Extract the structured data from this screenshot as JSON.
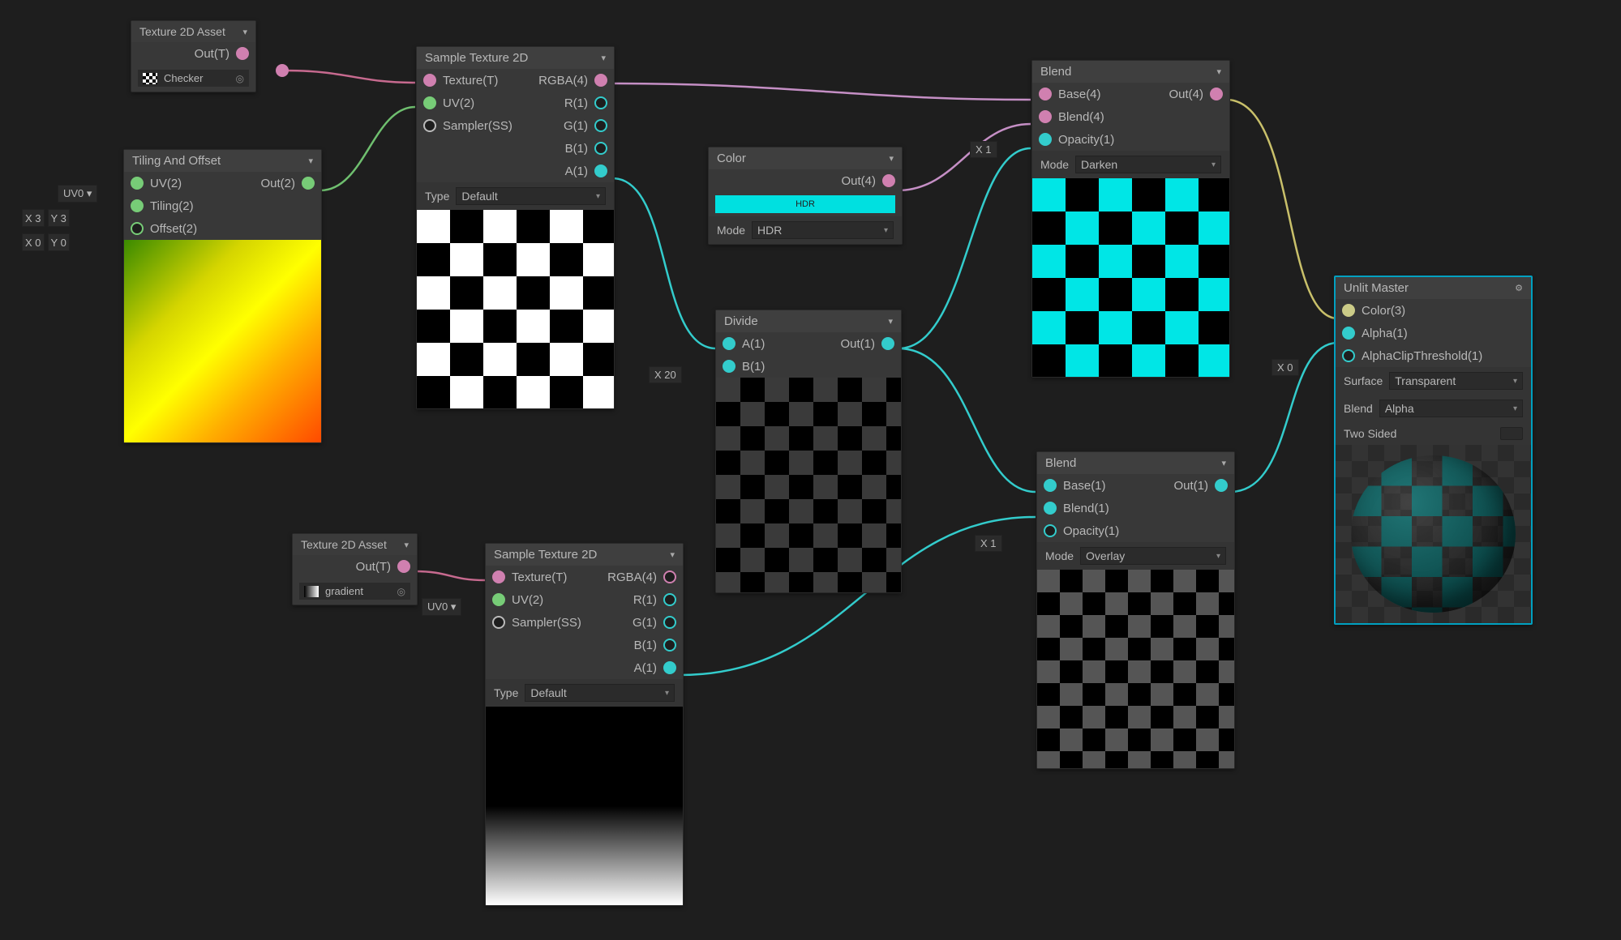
{
  "nodes": {
    "tex_asset_1": {
      "title": "Texture 2D Asset",
      "out": "Out(T)",
      "asset": "Checker"
    },
    "tex_asset_2": {
      "title": "Texture 2D Asset",
      "out": "Out(T)",
      "asset": "gradient"
    },
    "tiling": {
      "title": "Tiling And Offset",
      "inputs": [
        "UV(2)",
        "Tiling(2)",
        "Offset(2)"
      ],
      "out": "Out(2)",
      "uv_pill": "UV0",
      "tiling_x": "X 3",
      "tiling_y": "Y 3",
      "offset_x": "X 0",
      "offset_y": "Y 0"
    },
    "sample_1": {
      "title": "Sample Texture 2D",
      "inputs": [
        "Texture(T)",
        "UV(2)",
        "Sampler(SS)"
      ],
      "outputs": [
        "RGBA(4)",
        "R(1)",
        "G(1)",
        "B(1)",
        "A(1)"
      ],
      "type_label": "Type",
      "type_value": "Default"
    },
    "sample_2": {
      "title": "Sample Texture 2D",
      "inputs": [
        "Texture(T)",
        "UV(2)",
        "Sampler(SS)"
      ],
      "outputs": [
        "RGBA(4)",
        "R(1)",
        "G(1)",
        "B(1)",
        "A(1)"
      ],
      "uv_pill": "UV0",
      "type_label": "Type",
      "type_value": "Default"
    },
    "color": {
      "title": "Color",
      "out": "Out(4)",
      "bar": "HDR",
      "mode_label": "Mode",
      "mode_value": "HDR"
    },
    "divide": {
      "title": "Divide",
      "a": "A(1)",
      "b": "B(1)",
      "out": "Out(1)",
      "b_pill": "X 20"
    },
    "blend_1": {
      "title": "Blend",
      "base": "Base(4)",
      "blend": "Blend(4)",
      "opacity": "Opacity(1)",
      "out": "Out(4)",
      "op_pill": "X 1",
      "mode_label": "Mode",
      "mode_value": "Darken"
    },
    "blend_2": {
      "title": "Blend",
      "base": "Base(1)",
      "blend": "Blend(1)",
      "opacity": "Opacity(1)",
      "out": "Out(1)",
      "op_pill": "X 1",
      "mode_label": "Mode",
      "mode_value": "Overlay"
    },
    "master": {
      "title": "Unlit Master",
      "color": "Color(3)",
      "alpha": "Alpha(1)",
      "clip": "AlphaClipThreshold(1)",
      "clip_pill": "X 0",
      "surface_label": "Surface",
      "surface_value": "Transparent",
      "blend_label": "Blend",
      "blend_value": "Alpha",
      "twosided_label": "Two Sided"
    }
  }
}
